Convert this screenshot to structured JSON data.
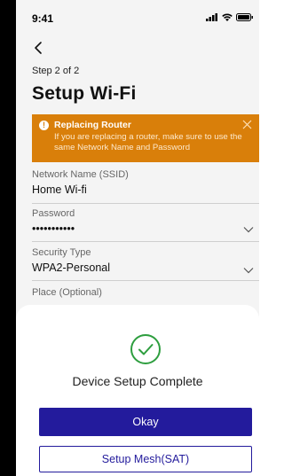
{
  "status_bar": {
    "time": "9:41"
  },
  "header": {
    "step": "Step 2 of 2",
    "title": "Setup Wi-Fi"
  },
  "alert": {
    "title": "Replacing Router",
    "body": "If you are replacing a router, make sure to use the same Network Name and Password",
    "color": "#d97f0a"
  },
  "form": {
    "ssid": {
      "label": "Network Name (SSID)",
      "value": "Home Wi-fi"
    },
    "password": {
      "label": "Password",
      "value": "•••••••••••"
    },
    "security": {
      "label": "Security Type",
      "value": "WPA2-Personal"
    },
    "place": {
      "label": "Place (Optional)"
    }
  },
  "dialog": {
    "message": "Device Setup Complete",
    "primary_label": "Okay",
    "secondary_label": "Setup Mesh(SAT)",
    "accent": "#231b9c",
    "check_color": "#2e9e3f"
  },
  "icons": [
    "back-chevron-icon",
    "signal-icon",
    "wifi-icon",
    "battery-icon",
    "alert-info-icon",
    "close-icon",
    "chevron-down-icon",
    "check-circle-icon"
  ]
}
